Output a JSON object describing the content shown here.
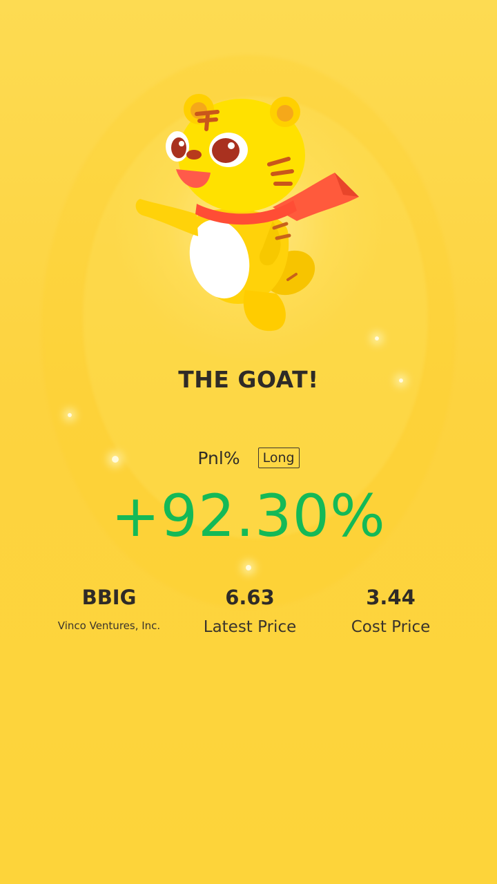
{
  "headline": "THE GOAT!",
  "pnl": {
    "label": "Pnl%",
    "direction": "Long",
    "value": "+92.30%",
    "color": "#14b957"
  },
  "stock": {
    "ticker": "BBIG",
    "company": "Vinco Ventures, Inc."
  },
  "latest_price": {
    "value": "6.63",
    "label": "Latest Price"
  },
  "cost_price": {
    "value": "3.44",
    "label": "Cost Price"
  },
  "mascot": {
    "icon": "tiger-mascot-icon"
  },
  "colors": {
    "background": "#fdd63c",
    "text": "#2f2b27",
    "positive": "#14b957"
  }
}
